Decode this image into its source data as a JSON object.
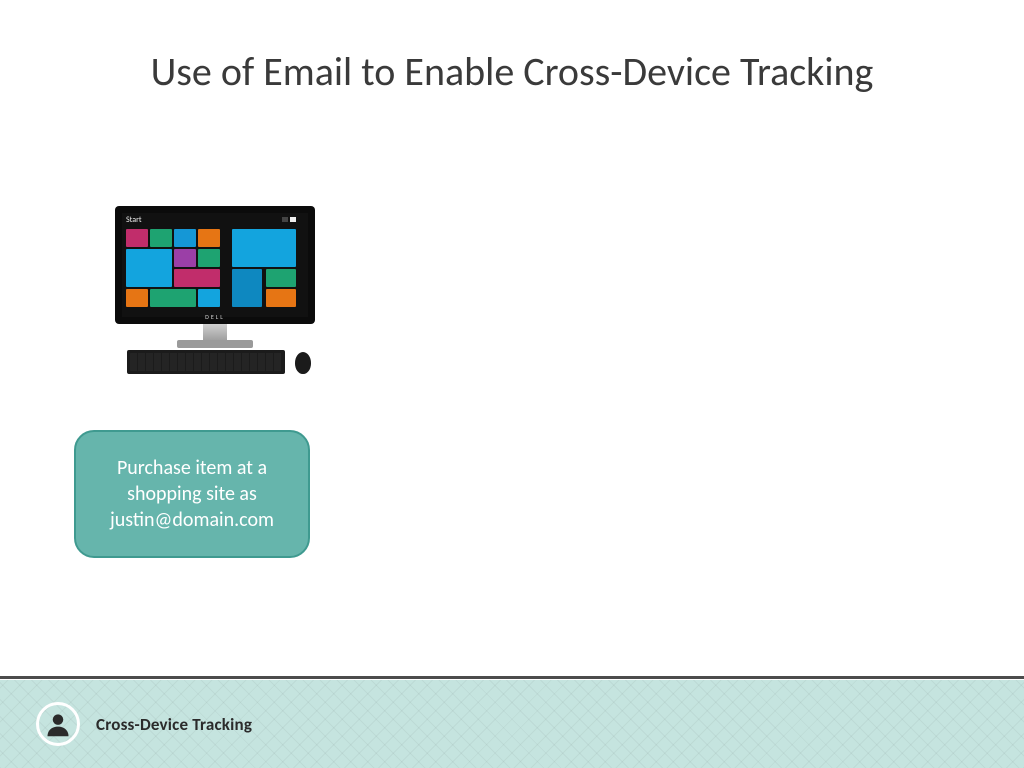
{
  "title": "Use of Email to Enable Cross-Device Tracking",
  "monitor": {
    "start_label": "Start",
    "brand": "DELL"
  },
  "callout": {
    "text": "Purchase item at a shopping site as justin@domain.com"
  },
  "footer": {
    "title": "Cross-Device Tracking"
  }
}
